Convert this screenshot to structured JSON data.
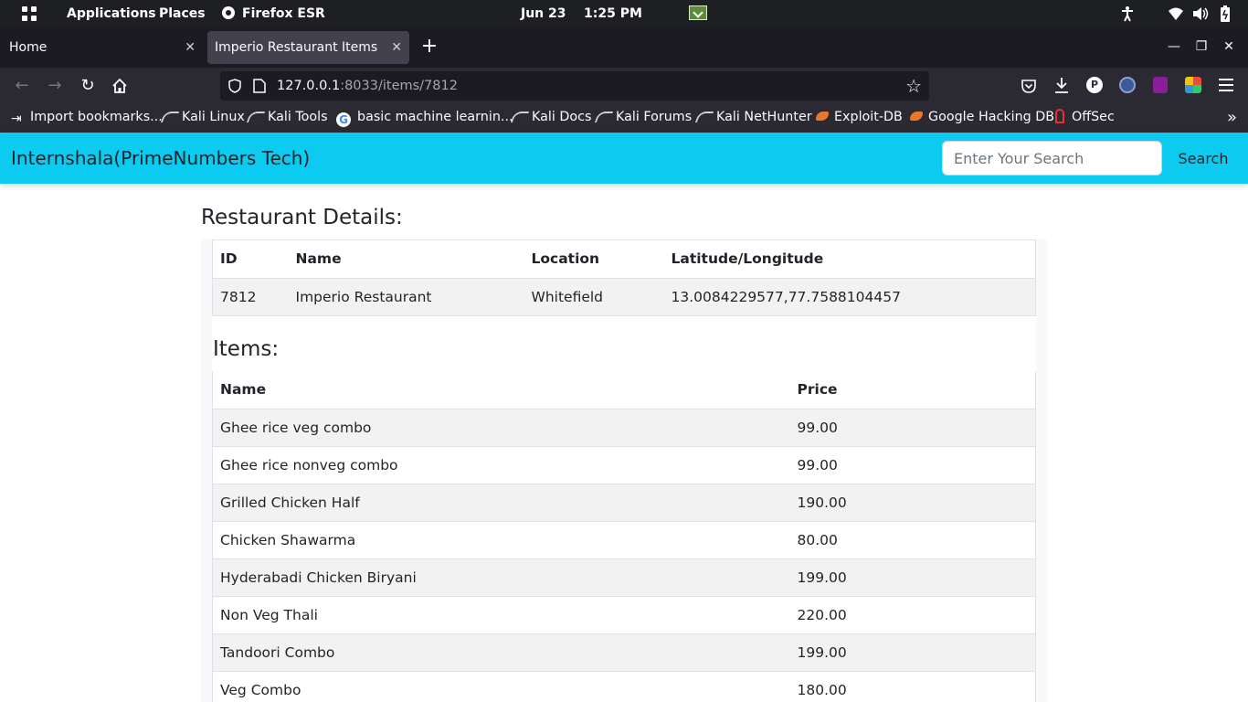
{
  "os_panel": {
    "applications": "Applications",
    "places": "Places",
    "active_app": "Firefox ESR",
    "date": "Jun 23",
    "time": "1:25 PM"
  },
  "browser": {
    "tabs": [
      {
        "title": "Home"
      },
      {
        "title": "Imperio Restaurant Items"
      }
    ],
    "url": {
      "host": "127.0.0.1",
      "rest": ":8033/items/7812"
    },
    "bookmarks": [
      "Import bookmarks...",
      "Kali Linux",
      "Kali Tools",
      "basic machine learnin...",
      "Kali Docs",
      "Kali Forums",
      "Kali NetHunter",
      "Exploit-DB",
      "Google Hacking DB",
      "OffSec"
    ],
    "profile_initial": "P"
  },
  "site": {
    "brand": "Internshala(PrimeNumbers Tech)",
    "search_placeholder": "Enter Your Search",
    "search_button": "Search"
  },
  "restaurant": {
    "heading": "Restaurant Details:",
    "columns": [
      "ID",
      "Name",
      "Location",
      "Latitude/Longitude"
    ],
    "row": {
      "id": "7812",
      "name": "Imperio Restaurant",
      "location": "Whitefield",
      "latlng": "13.0084229577,77.7588104457"
    }
  },
  "items": {
    "heading": "Items:",
    "columns": [
      "Name",
      "Price"
    ],
    "rows": [
      {
        "name": "Ghee rice veg combo",
        "price": "99.00"
      },
      {
        "name": "Ghee rice nonveg combo",
        "price": "99.00"
      },
      {
        "name": "Grilled Chicken Half",
        "price": "190.00"
      },
      {
        "name": "Chicken Shawarma",
        "price": "80.00"
      },
      {
        "name": "Hyderabadi Chicken Biryani",
        "price": "199.00"
      },
      {
        "name": "Non Veg Thali",
        "price": "220.00"
      },
      {
        "name": "Tandoori Combo",
        "price": "199.00"
      },
      {
        "name": "Veg Combo",
        "price": "180.00"
      }
    ]
  }
}
